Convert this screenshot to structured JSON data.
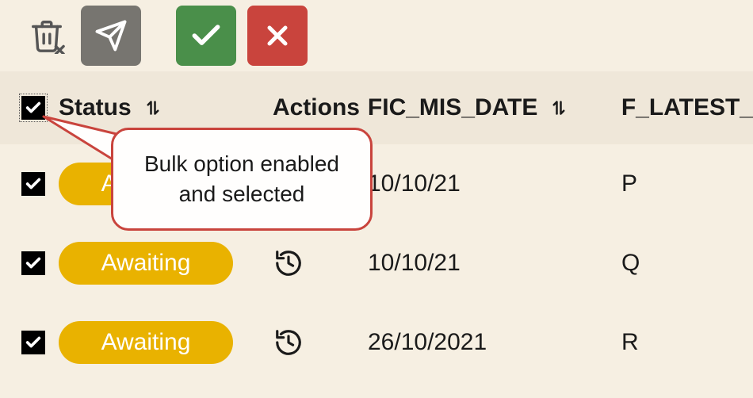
{
  "toolbar": {
    "delete_name": "delete",
    "send_name": "send",
    "approve_name": "approve",
    "reject_name": "reject"
  },
  "columns": {
    "status": "Status",
    "actions": "Actions",
    "fic_mis_date": "FIC_MIS_DATE",
    "f_latest": "F_LATEST_"
  },
  "callout_text": "Bulk option enabled and selected",
  "rows": [
    {
      "checked": true,
      "status": "Awaiting",
      "date": "10/10/21",
      "latest": "P"
    },
    {
      "checked": true,
      "status": "Awaiting",
      "date": "10/10/21",
      "latest": "Q"
    },
    {
      "checked": true,
      "status": "Awaiting",
      "date": "26/10/2021",
      "latest": "R"
    }
  ],
  "colors": {
    "accent_yellow": "#e9b200",
    "approve_green": "#4a8f4a",
    "reject_red": "#c9443d",
    "toolbar_grey": "#777570",
    "bg": "#f6efe2",
    "header_bg": "#efe7d9"
  }
}
